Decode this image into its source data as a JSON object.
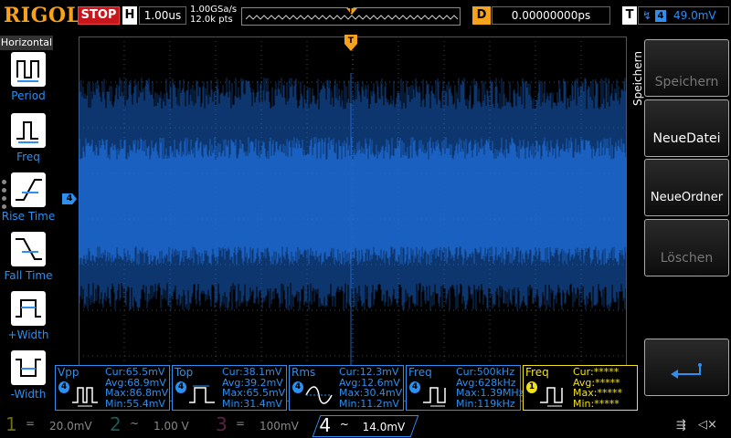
{
  "topbar": {
    "brand": "RIGOL",
    "run_state": "STOP",
    "h_label": "H",
    "timebase": "1.00us",
    "sample_rate": "1.00GSa/s",
    "points": "12.0k pts",
    "trigger_pos_marker": "T",
    "d_label": "D",
    "delay": "0.00000000ps",
    "t_label": "T",
    "trigger_edge": "rising-edge-icon",
    "trigger_source": "4",
    "trigger_level": "49.0mV"
  },
  "left_menu": {
    "title": "Horizontal",
    "items": [
      {
        "label": "Period",
        "icon": "period-icon"
      },
      {
        "label": "Freq",
        "icon": "freq-icon"
      },
      {
        "label": "Rise Time",
        "icon": "rise-time-icon"
      },
      {
        "label": "Fall Time",
        "icon": "fall-time-icon"
      },
      {
        "label": "+Width",
        "icon": "pos-width-icon"
      },
      {
        "label": "-Width",
        "icon": "neg-width-icon"
      }
    ]
  },
  "screen": {
    "channel_marker": "4",
    "trigger_marker": "T",
    "trace_color": "#1a63c9"
  },
  "right_menu": {
    "title": "Speichern",
    "buttons": [
      {
        "label": "Speichern",
        "enabled": false
      },
      {
        "label": "NeueDatei",
        "enabled": true
      },
      {
        "label": "NeueOrdner",
        "enabled": true
      },
      {
        "label": "Löschen",
        "enabled": false
      },
      {
        "label": "",
        "icon": "return-icon",
        "enabled": true
      }
    ]
  },
  "measurements": [
    {
      "name": "Vpp",
      "channel": "4",
      "cur": "Cur:65.5mV",
      "avg": "Avg:68.9mV",
      "max": "Max:86.8mV",
      "min": "Min:55.4mV"
    },
    {
      "name": "Top",
      "channel": "4",
      "cur": "Cur:38.1mV",
      "avg": "Avg:39.2mV",
      "max": "Max:65.5mV",
      "min": "Min:31.4mV"
    },
    {
      "name": "Rms",
      "channel": "4",
      "cur": "Cur:12.3mV",
      "avg": "Avg:12.6mV",
      "max": "Max:30.4mV",
      "min": "Min:11.2mV"
    },
    {
      "name": "Freq",
      "channel": "4",
      "cur": "Cur:500kHz",
      "avg": "Avg:628kHz",
      "max": "Max:1.39MHz",
      "min": "Min:119kHz"
    },
    {
      "name": "Freq",
      "channel": "1",
      "cur": "Cur:*****",
      "avg": "Avg:*****",
      "max": "Max:*****",
      "min": "Min:*****"
    }
  ],
  "channels": [
    {
      "num": "1",
      "coupling": "=",
      "scale": "20.0mV",
      "active": false
    },
    {
      "num": "2",
      "coupling": "~",
      "scale": "1.00 V",
      "active": false
    },
    {
      "num": "3",
      "coupling": "=",
      "scale": "100mV",
      "active": false
    },
    {
      "num": "4",
      "coupling": "~",
      "scale": "14.0mV",
      "active": true
    }
  ],
  "status_icons": {
    "usb": "usb-icon",
    "speaker": "speaker-muted-icon"
  }
}
